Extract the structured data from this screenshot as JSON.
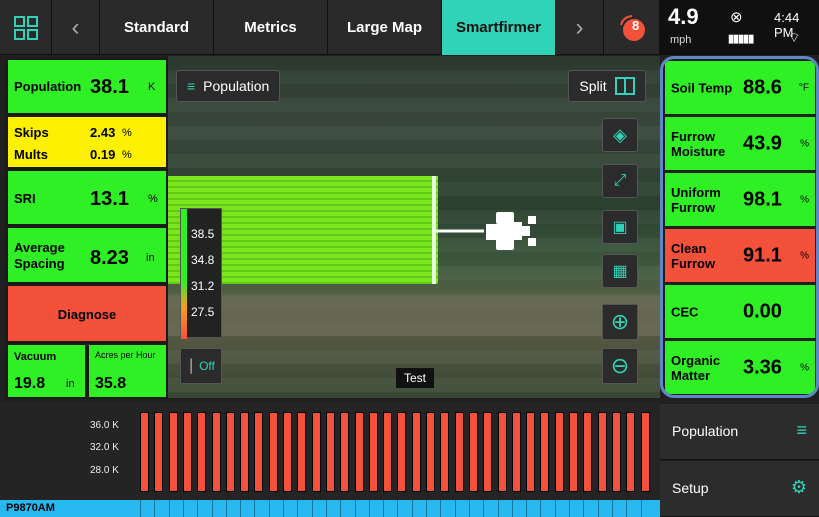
{
  "topbar": {
    "tabs": [
      {
        "label": "Standard"
      },
      {
        "label": "Metrics"
      },
      {
        "label": "Large Map"
      },
      {
        "label": "Smartfirmer"
      }
    ],
    "alarm_count": "8"
  },
  "status": {
    "speed": "4.9",
    "speed_unit": "mph",
    "time": "4:44 PM"
  },
  "left": {
    "population": {
      "label": "Population",
      "value": "38.1",
      "unit": "K"
    },
    "skips": {
      "label": "Skips",
      "value": "2.43",
      "unit": "%"
    },
    "mults": {
      "label": "Mults",
      "value": "0.19",
      "unit": "%"
    },
    "sri": {
      "label": "SRI",
      "value": "13.1",
      "unit": "%"
    },
    "spacing": {
      "label": "Average Spacing",
      "value": "8.23",
      "unit": "in"
    },
    "diagnose": {
      "label": "Diagnose"
    },
    "vacuum": {
      "label": "Vacuum",
      "value": "19.8",
      "unit": "in"
    },
    "acres": {
      "label": "Acres per Hour",
      "value": "35.8"
    }
  },
  "map": {
    "layer_button": "Population",
    "split_button": "Split",
    "legend": [
      "38.5",
      "34.8",
      "31.2",
      "27.5"
    ],
    "toggle_label": "Off",
    "test_label": "Test"
  },
  "right": {
    "tiles": [
      {
        "name": "Soil Temp",
        "value": "88.6",
        "unit": "°F",
        "color": "#2ef024"
      },
      {
        "name": "Furrow Moisture",
        "value": "43.9",
        "unit": "%",
        "color": "#2ef024"
      },
      {
        "name": "Uniform Furrow",
        "value": "98.1",
        "unit": "%",
        "color": "#2ef024"
      },
      {
        "name": "Clean Furrow",
        "value": "91.1",
        "unit": "%",
        "color": "#f4513b"
      },
      {
        "name": "CEC",
        "value": "0.00",
        "unit": "",
        "color": "#2ef024"
      },
      {
        "name": "Organic Matter",
        "value": "3.36",
        "unit": "%",
        "color": "#2ef024"
      }
    ]
  },
  "bottom": {
    "yticks": [
      "36.0 K",
      "32.0 K",
      "28.0 K"
    ],
    "planter_name": "P9870AM",
    "row_count": 36
  },
  "menu": {
    "population": "Population",
    "setup": "Setup"
  },
  "colors": {
    "accent": "#31d3b8",
    "ok": "#2ef024",
    "warn": "#fdf000",
    "alert": "#f4513b",
    "highlight": "#5e86c9"
  }
}
